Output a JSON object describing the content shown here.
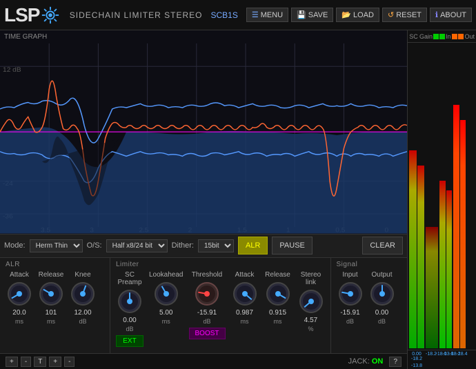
{
  "app": {
    "logo": "LSP",
    "title": "SIDECHAIN LIMITER STEREO",
    "id": "SCB1S",
    "gear_icon": "⚙"
  },
  "header": {
    "menu_label": "MENU",
    "save_label": "SAVE",
    "load_label": "LOAD",
    "reset_label": "RESET",
    "about_label": "ABOUT"
  },
  "time_graph": {
    "label": "TIME GRAPH",
    "db_labels": [
      "12 dB",
      "-24",
      "-36"
    ],
    "time_labels": [
      "3.5",
      "3",
      "2.5",
      "2",
      "1.5",
      "1",
      "0.5",
      "0"
    ]
  },
  "controls": {
    "mode_label": "Mode:",
    "mode_value": "Herm Thin",
    "os_label": "O/S:",
    "os_value": "Half x8/24 bit",
    "dither_label": "Dither:",
    "dither_value": "15bit",
    "alr_label": "ALR",
    "pause_label": "PAUSE",
    "clear_label": "CLEAR"
  },
  "alr": {
    "section_label": "ALR",
    "attack_label": "Attack",
    "attack_value": "20.0",
    "attack_unit": "ms",
    "release_label": "Release",
    "release_value": "101",
    "release_unit": "ms",
    "knee_label": "Knee",
    "knee_value": "12.00",
    "knee_unit": "dB"
  },
  "limiter": {
    "section_label": "Limiter",
    "sc_preamp_label": "SC Preamp",
    "sc_preamp_value": "0.00",
    "sc_preamp_unit": "dB",
    "ext_label": "EXT",
    "lookahead_label": "Lookahead",
    "lookahead_value": "5.00",
    "lookahead_unit": "ms",
    "threshold_label": "Threshold",
    "threshold_value": "-15.91",
    "threshold_unit": "dB",
    "boost_label": "BOOST",
    "attack_label": "Attack",
    "attack_value": "0.987",
    "attack_unit": "ms",
    "release_label": "Release",
    "release_value": "0.915",
    "release_unit": "ms",
    "stereolink_label": "Stereo link",
    "stereolink_value": "4.57",
    "stereolink_unit": "%"
  },
  "signal": {
    "section_label": "Signal",
    "input_label": "Input",
    "input_value": "-15.91",
    "input_unit": "dB",
    "output_label": "Output",
    "output_value": "0.00",
    "output_unit": "dB"
  },
  "meters": {
    "sc_label": "SC",
    "gain_label": "Gain",
    "in_label": "In",
    "out_label": "Out",
    "val1": "0.00",
    "val2": "-18.2",
    "val3": "-18.2",
    "val4": "-18.0",
    "val5": "-13.8",
    "val6": "-18.2",
    "val7": "-18.4",
    "val8": "-13.8"
  },
  "footer": {
    "add_label": "+",
    "remove_label": "-",
    "jack_label": "JACK:",
    "jack_status": "ON",
    "help_label": "?"
  }
}
